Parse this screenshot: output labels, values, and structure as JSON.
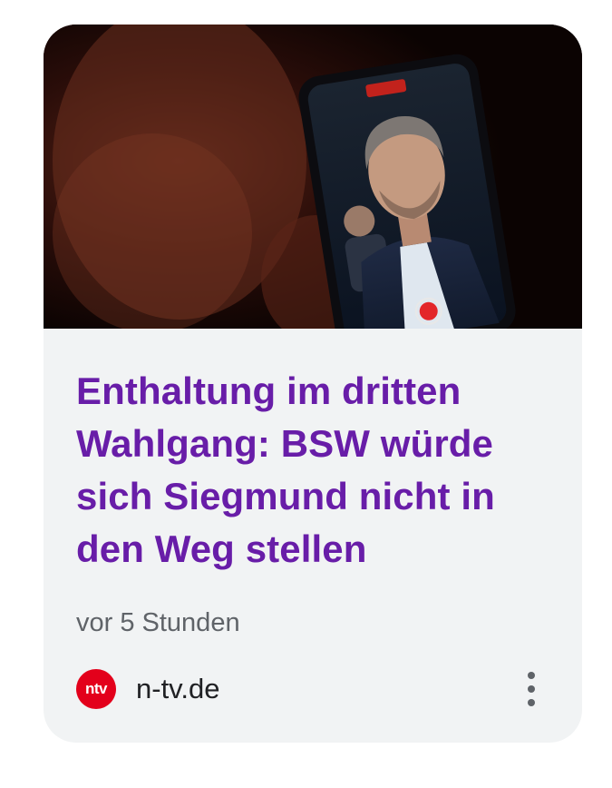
{
  "article": {
    "headline": "Enthaltung im dritten Wahlgang: BSW würde sich Siegmund nicht in den Weg stellen",
    "time": "vor 5 Stunden",
    "source": "n-tv.de",
    "source_logo_text": "ntv",
    "thumbnail_icon": "photo-person-on-phone-screen",
    "more_icon": "more-vert-icon"
  },
  "colors": {
    "headline": "#681da8",
    "card_background": "#f1f3f4",
    "logo": "#e3001b",
    "meta_text": "#5f6368"
  }
}
